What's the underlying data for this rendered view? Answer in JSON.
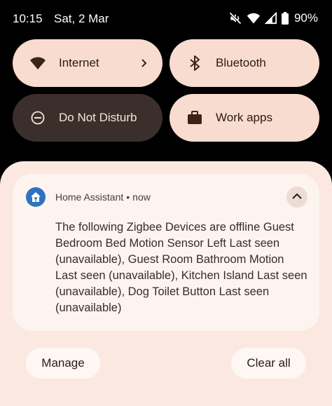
{
  "status_bar": {
    "time": "10:15",
    "date": "Sat, 2 Mar",
    "battery_percent": "90%",
    "icons": [
      "mute-icon",
      "wifi-icon",
      "signal-icon",
      "battery-icon"
    ]
  },
  "quick_tiles": {
    "internet": {
      "label": "Internet",
      "icon": "wifi-icon"
    },
    "bluetooth": {
      "label": "Bluetooth",
      "icon": "bluetooth-icon"
    },
    "dnd": {
      "label": "Do Not Disturb",
      "icon": "do-not-disturb-icon"
    },
    "work": {
      "label": "Work apps",
      "icon": "briefcase-icon"
    }
  },
  "notification": {
    "app_name": "Home Assistant",
    "separator": "•",
    "time": "now",
    "body": "The following Zigbee Devices are offline Guest Bedroom Bed Motion Sensor Left Last seen (unavailable), Guest Room Bathroom Motion Last seen (unavailable), Kitchen Island Last seen (unavailable), Dog Toilet Button Last seen (unavailable)",
    "app_icon": "home-assistant-icon",
    "accent_color": "#2f72c1"
  },
  "actions": {
    "manage_label": "Manage",
    "clear_all_label": "Clear all"
  },
  "colors": {
    "tile_active": "#f8dccf",
    "tile_inactive": "#3a2f2b",
    "shade_bg": "#fbe9e1"
  }
}
